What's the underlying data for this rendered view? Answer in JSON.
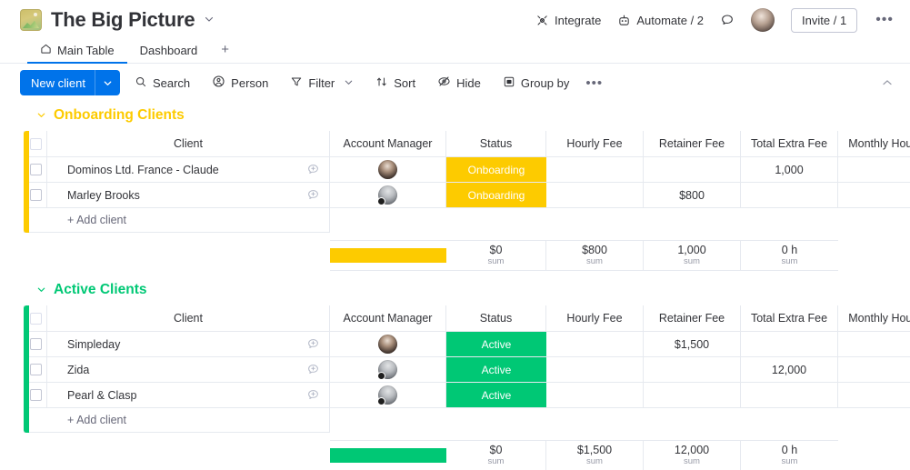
{
  "header": {
    "board_icon": "picture-icon",
    "title": "The Big Picture",
    "title_chevron": "chevron-down-icon",
    "integrate_label": "Integrate",
    "automate_label": "Automate / 2",
    "chat_icon": "chat-bubble-icon",
    "avatar": "user-avatar",
    "invite_label": "Invite / 1",
    "more_label": "•••"
  },
  "tabs": [
    {
      "label": "Main Table",
      "icon": "home-icon",
      "active": true
    },
    {
      "label": "Dashboard",
      "icon": "",
      "active": false
    }
  ],
  "tab_add_label": "+",
  "toolbar": {
    "new_item_label": "New client",
    "new_item_chevron": "chevron-down-icon",
    "search_label": "Search",
    "person_label": "Person",
    "filter_label": "Filter",
    "filter_chevron": "chevron-down-icon",
    "sort_label": "Sort",
    "hide_label": "Hide",
    "group_by_label": "Group by",
    "more_label": "•••",
    "collapse_icon": "chevron-up-icon"
  },
  "columns": [
    "Client",
    "Account Manager",
    "Status",
    "Hourly Fee",
    "Retainer Fee",
    "Total Extra Fee",
    "Monthly Hours"
  ],
  "colors": {
    "accent_blue": "#0073ea",
    "onboarding_yellow": "#fdcb00",
    "active_green": "#00c875",
    "border": "#e6e9ef",
    "text": "#323338",
    "muted": "#676879"
  },
  "groups": [
    {
      "title": "Onboarding Clients",
      "color": "#fdcb00",
      "chevron": "chevron-down-icon",
      "add_label": "+ Add client",
      "rows": [
        {
          "client": "Dominos Ltd. France - Claude",
          "avatar": "a1",
          "avatar_badge": false,
          "status": "Onboarding",
          "hourly_fee": "",
          "retainer_fee": "",
          "total_extra_fee": "1,000",
          "monthly_hours": ""
        },
        {
          "client": "Marley Brooks",
          "avatar": "a2",
          "avatar_badge": true,
          "status": "Onboarding",
          "hourly_fee": "",
          "retainer_fee": "$800",
          "total_extra_fee": "",
          "monthly_hours": ""
        }
      ],
      "summary": {
        "hourly_fee": "$0",
        "hourly_fee_label": "sum",
        "retainer_fee": "$800",
        "retainer_fee_label": "sum",
        "total_extra_fee": "1,000",
        "total_extra_fee_label": "sum",
        "monthly_hours": "0 h",
        "monthly_hours_label": "sum"
      }
    },
    {
      "title": "Active Clients",
      "color": "#00c875",
      "chevron": "chevron-down-icon",
      "add_label": "+ Add client",
      "rows": [
        {
          "client": "Simpleday",
          "avatar": "a1",
          "avatar_badge": false,
          "status": "Active",
          "hourly_fee": "",
          "retainer_fee": "$1,500",
          "total_extra_fee": "",
          "monthly_hours": ""
        },
        {
          "client": "Zida",
          "avatar": "a2",
          "avatar_badge": true,
          "status": "Active",
          "hourly_fee": "",
          "retainer_fee": "",
          "total_extra_fee": "12,000",
          "monthly_hours": ""
        },
        {
          "client": "Pearl & Clasp",
          "avatar": "a2",
          "avatar_badge": true,
          "status": "Active",
          "hourly_fee": "",
          "retainer_fee": "",
          "total_extra_fee": "",
          "monthly_hours": ""
        }
      ],
      "summary": {
        "hourly_fee": "$0",
        "hourly_fee_label": "sum",
        "retainer_fee": "$1,500",
        "retainer_fee_label": "sum",
        "total_extra_fee": "12,000",
        "total_extra_fee_label": "sum",
        "monthly_hours": "0 h",
        "monthly_hours_label": "sum"
      }
    }
  ]
}
